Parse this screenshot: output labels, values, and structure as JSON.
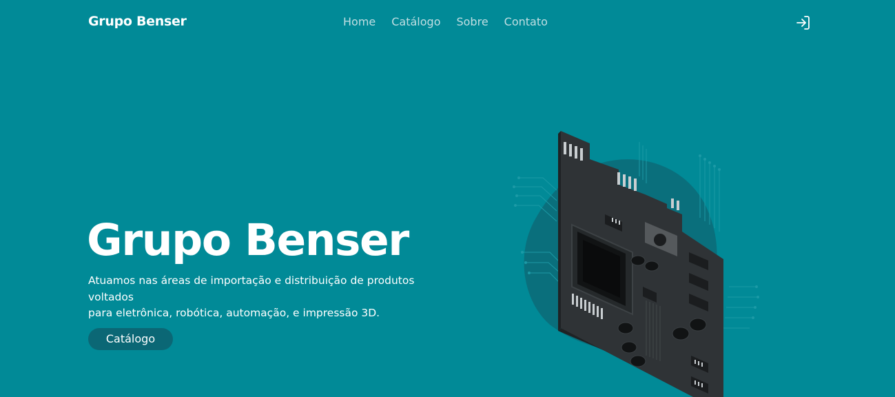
{
  "header": {
    "brand": "Grupo Benser",
    "nav": [
      "Home",
      "Catálogo",
      "Sobre",
      "Contato"
    ],
    "login_icon": "sign-in-icon"
  },
  "hero": {
    "title": "Grupo Benser",
    "description_line1": "Atuamos nas áreas de importação e distribuição de produtos voltados",
    "description_line2": "para eletrônica, robótica, automação, e impressão 3D.",
    "cta_label": "Catálogo",
    "illustration_icon": "circuit-board-illustration"
  },
  "colors": {
    "background": "#018a97",
    "nav_link": "#c2dfe3",
    "button": "#0b6775",
    "board": "#2f3336",
    "blob": "#0a6f7c"
  }
}
